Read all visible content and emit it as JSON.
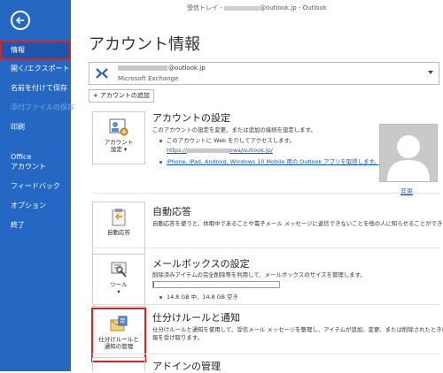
{
  "window": {
    "title_prefix": "受信トレイ - ",
    "title_suffix": "@outlook.jp - Outlook"
  },
  "sidebar": {
    "items": [
      {
        "label": "情報"
      },
      {
        "label": "開く/エクスポート"
      },
      {
        "label": "名前を付けて保存"
      },
      {
        "label": "添付ファイルの保存"
      },
      {
        "label": "印刷"
      },
      {
        "label_line1": "Office",
        "label_line2": "アカウント"
      },
      {
        "label": "フィードバック"
      },
      {
        "label": "オプション"
      },
      {
        "label": "終了"
      }
    ]
  },
  "main": {
    "page_title": "アカウント情報",
    "account": {
      "email_suffix": "@outlook.jp",
      "type": "Microsoft Exchange"
    },
    "add_account_label": "アカウントの追加",
    "account_settings": {
      "tile_line1": "アカウント",
      "tile_line2": "設定 ▾",
      "title": "アカウントの設定",
      "desc": "このアカウントの設定を変更、または追加の接続を設定します。",
      "bullet1": "このアカウントに Web を介してアクセスします。",
      "link_prefix": "https://",
      "link_suffix": "owa/outlook.jp/",
      "bullet2_link": "iPhone, iPad, Android, Windows 10 Mobile 用の Outlook アプリを取得します。"
    },
    "avatar": {
      "change_label": "変更"
    },
    "auto_reply": {
      "tile_label": "自動応答",
      "title": "自動応答",
      "desc": "自動応答を使うと、休暇中であることや電子メール メッセージに返信できないことを他の人に知らせることができます。"
    },
    "mailbox": {
      "tile_line1": "ツール",
      "tile_line2": "▾",
      "title": "メールボックスの設定",
      "desc": "削除済みアイテムの完全削除等を利用して、メールボックスのサイズを管理します。",
      "usage_text": "14.8 GB 中、14.8 GB 空き",
      "usage_fraction": 0.01
    },
    "rules": {
      "tile_line1": "仕分けルールと",
      "tile_line2": "通知の管理",
      "title": "仕分けルールと通知",
      "desc_line1": "仕分けルールと通知を使用して、受信メール メッセージを整理し、アイテムが追加、変更、または削除されたときに更新情",
      "desc_line2": "報を受け取ります。"
    },
    "addins": {
      "title": "アドインの管理"
    }
  },
  "colors": {
    "sidebar_bg": "#2468c4",
    "selected_bg": "#1a57ad",
    "highlight": "#e0201e",
    "link": "#1a58b8"
  },
  "icons": [
    "back-arrow-icon",
    "exchange-icon",
    "plus-icon",
    "account-settings-icon",
    "auto-reply-icon",
    "tools-icon",
    "rules-icon",
    "person-silhouette-icon",
    "dropdown-caret-icon"
  ]
}
